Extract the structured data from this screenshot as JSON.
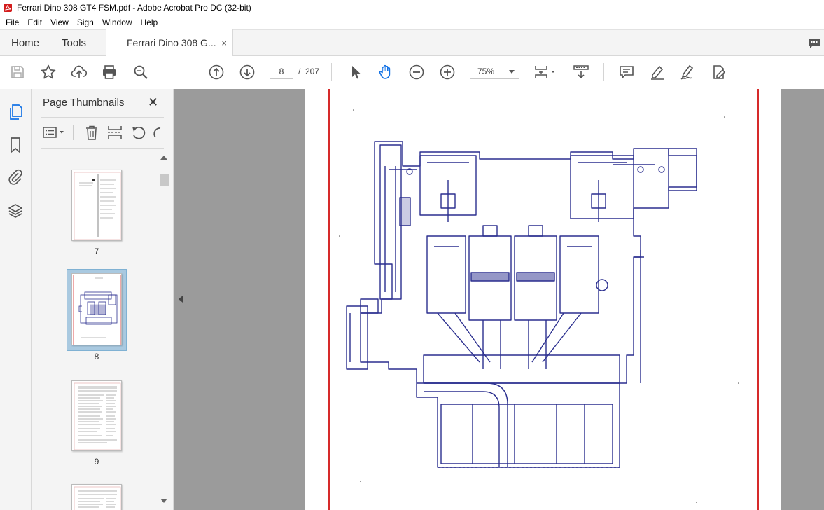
{
  "window": {
    "title": "Ferrari Dino 308 GT4 FSM.pdf - Adobe Acrobat Pro DC (32-bit)"
  },
  "menubar": [
    "File",
    "Edit",
    "View",
    "Sign",
    "Window",
    "Help"
  ],
  "tabs": {
    "home": "Home",
    "tools": "Tools",
    "document": "Ferrari Dino 308 G...",
    "close": "×"
  },
  "toolbar": {
    "current_page": "8",
    "page_separator": "/",
    "total_pages": "207",
    "zoom": "75%"
  },
  "thumbnails_panel": {
    "title": "Page Thumbnails",
    "close": "✕",
    "pages": [
      {
        "label": "7",
        "selected": false
      },
      {
        "label": "8",
        "selected": true
      },
      {
        "label": "9",
        "selected": false
      },
      {
        "label": "",
        "selected": false
      }
    ]
  },
  "colors": {
    "accent_red": "#d62a2a",
    "drawing_blue": "#2b2f8f",
    "selection_blue": "#a9c9e0"
  },
  "icons": [
    "save-icon",
    "star-icon",
    "upload-icon",
    "print-icon",
    "zoom-search-icon",
    "page-up-icon",
    "page-down-icon",
    "select-cursor-icon",
    "hand-icon",
    "zoom-out-icon",
    "zoom-in-icon",
    "page-fit-icon",
    "scroll-mode-icon",
    "comment-icon",
    "highlight-icon",
    "sign-icon",
    "edit-pdf-icon"
  ]
}
